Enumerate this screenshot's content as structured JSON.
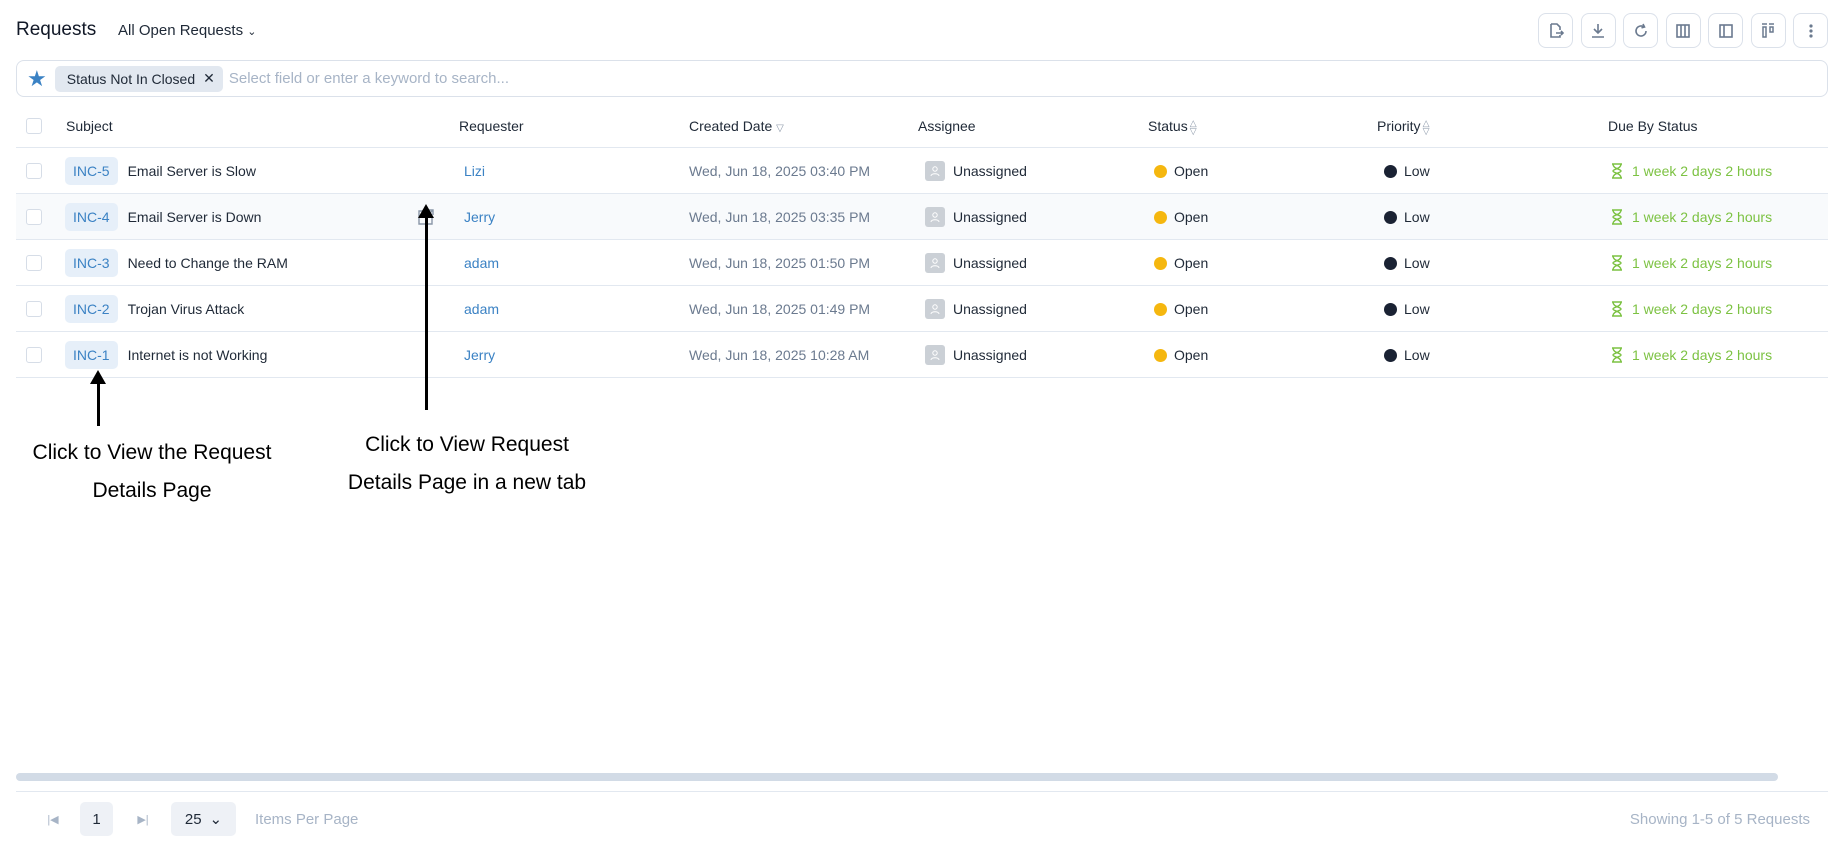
{
  "header": {
    "title": "Requests",
    "view": "All Open Requests"
  },
  "toolbar": [
    "export-icon",
    "download-icon",
    "refresh-icon",
    "columns-icon",
    "panel-icon",
    "layout-icon",
    "more-icon"
  ],
  "search": {
    "chip": "Status Not In Closed",
    "placeholder": "Select field or enter a keyword to search..."
  },
  "columns": {
    "subject": "Subject",
    "requester": "Requester",
    "created": "Created Date",
    "assignee": "Assignee",
    "status": "Status",
    "priority": "Priority",
    "due": "Due By Status"
  },
  "rows": [
    {
      "id": "INC-5",
      "subject": "Email Server is Slow",
      "requester": "Lizi",
      "created": "Wed, Jun 18, 2025 03:40 PM",
      "assignee": "Unassigned",
      "status": "Open",
      "priority": "Low",
      "due": "1 week 2 days 2 hours"
    },
    {
      "id": "INC-4",
      "subject": "Email Server is Down",
      "requester": "Jerry",
      "created": "Wed, Jun 18, 2025 03:35 PM",
      "assignee": "Unassigned",
      "status": "Open",
      "priority": "Low",
      "due": "1 week 2 days 2 hours"
    },
    {
      "id": "INC-3",
      "subject": "Need to Change the RAM",
      "requester": "adam",
      "created": "Wed, Jun 18, 2025 01:50 PM",
      "assignee": "Unassigned",
      "status": "Open",
      "priority": "Low",
      "due": "1 week 2 days 2 hours"
    },
    {
      "id": "INC-2",
      "subject": "Trojan Virus Attack",
      "requester": "adam",
      "created": "Wed, Jun 18, 2025 01:49 PM",
      "assignee": "Unassigned",
      "status": "Open",
      "priority": "Low",
      "due": "1 week 2 days 2 hours"
    },
    {
      "id": "INC-1",
      "subject": "Internet is not Working",
      "requester": "Jerry",
      "created": "Wed, Jun 18, 2025 10:28 AM",
      "assignee": "Unassigned",
      "status": "Open",
      "priority": "Low",
      "due": "1 week 2 days 2 hours"
    }
  ],
  "annotations": {
    "view_details_1": "Click to View the Request",
    "view_details_2": "Details Page",
    "new_tab_1": "Click to View Request",
    "new_tab_2": "Details Page in a new tab"
  },
  "pagination": {
    "page": "1",
    "per_page": "25",
    "per_page_label": "Items Per Page",
    "summary": "Showing 1-5 of 5 Requests"
  },
  "colors": {
    "status_open": "#f5b70f",
    "priority_low": "#1a2233",
    "due": "#7cc242",
    "link": "#3b82c4"
  }
}
